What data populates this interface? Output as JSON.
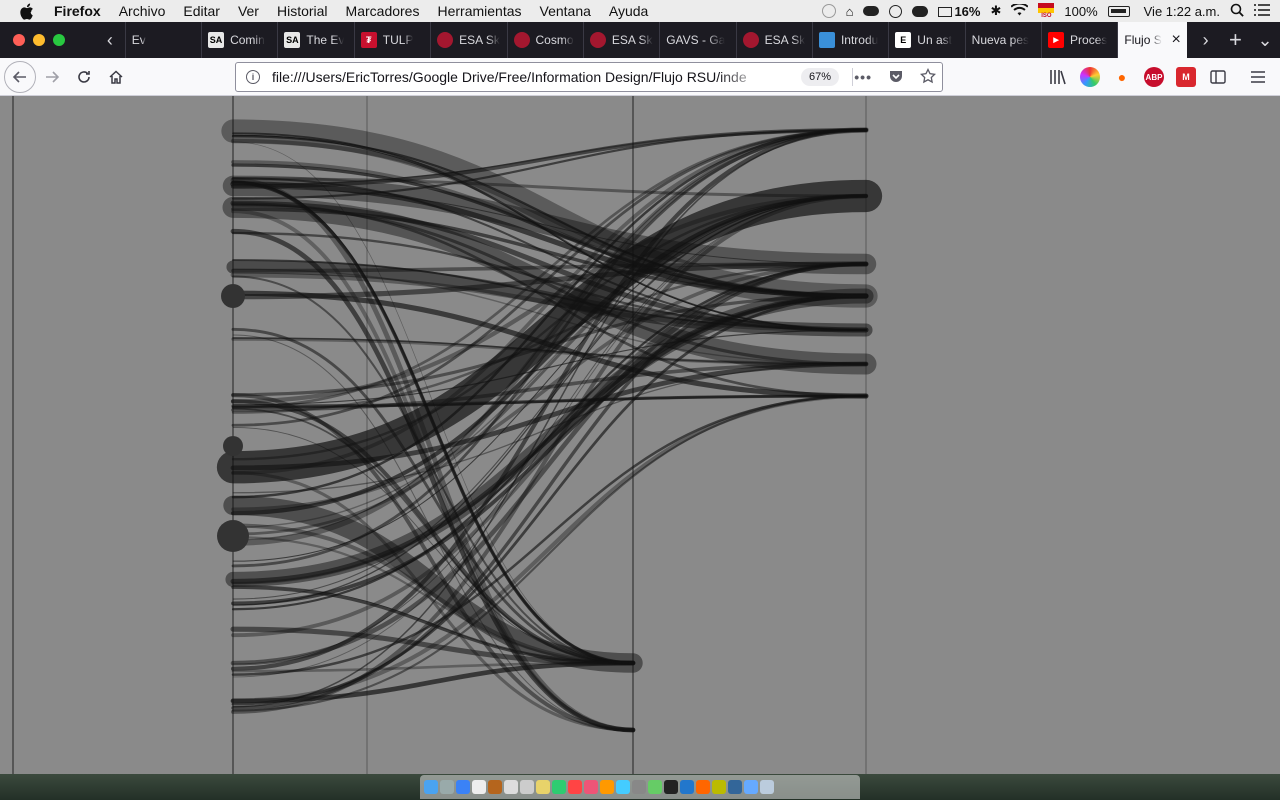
{
  "menubar": {
    "app_name": "Firefox",
    "items": [
      "Archivo",
      "Editar",
      "Ver",
      "Historial",
      "Marcadores",
      "Herramientas",
      "Ventana",
      "Ayuda"
    ],
    "cpu": "16%",
    "battery": "100%",
    "clock": "Vie 1:22 a.m.",
    "flag_label": "ISO"
  },
  "tabs": [
    {
      "title": "Ev",
      "favicon": "generic"
    },
    {
      "title": "Comin",
      "favicon": "SA"
    },
    {
      "title": "The Ev",
      "favicon": "SA"
    },
    {
      "title": "TULP",
      "favicon": "tulp"
    },
    {
      "title": "ESA Sk",
      "favicon": "esa"
    },
    {
      "title": "Cosmo",
      "favicon": "esa"
    },
    {
      "title": "ESA Sk",
      "favicon": "esa"
    },
    {
      "title": "GAVS - Ga",
      "favicon": "none"
    },
    {
      "title": "ESA Sk",
      "favicon": "esa"
    },
    {
      "title": "Introdu",
      "favicon": "intro"
    },
    {
      "title": "Un ast",
      "favicon": "E"
    },
    {
      "title": "Nueva pes",
      "favicon": "none"
    },
    {
      "title": "Proces",
      "favicon": "youtube"
    }
  ],
  "active_tab": {
    "title": "Flujo S",
    "close": "×"
  },
  "tab_controls": {
    "next": "›",
    "new_tab": "+",
    "list": "⌄",
    "prev": "‹"
  },
  "navbar": {
    "url": "file:///Users/EricTorres/Google Drive/Free/Information Design/Flujo RSU/inde",
    "zoom": "67%",
    "page_actions": "•••",
    "abp_label": "ABP"
  },
  "chart_data": {
    "type": "sankey",
    "columns": 4,
    "flows_description": null
  }
}
